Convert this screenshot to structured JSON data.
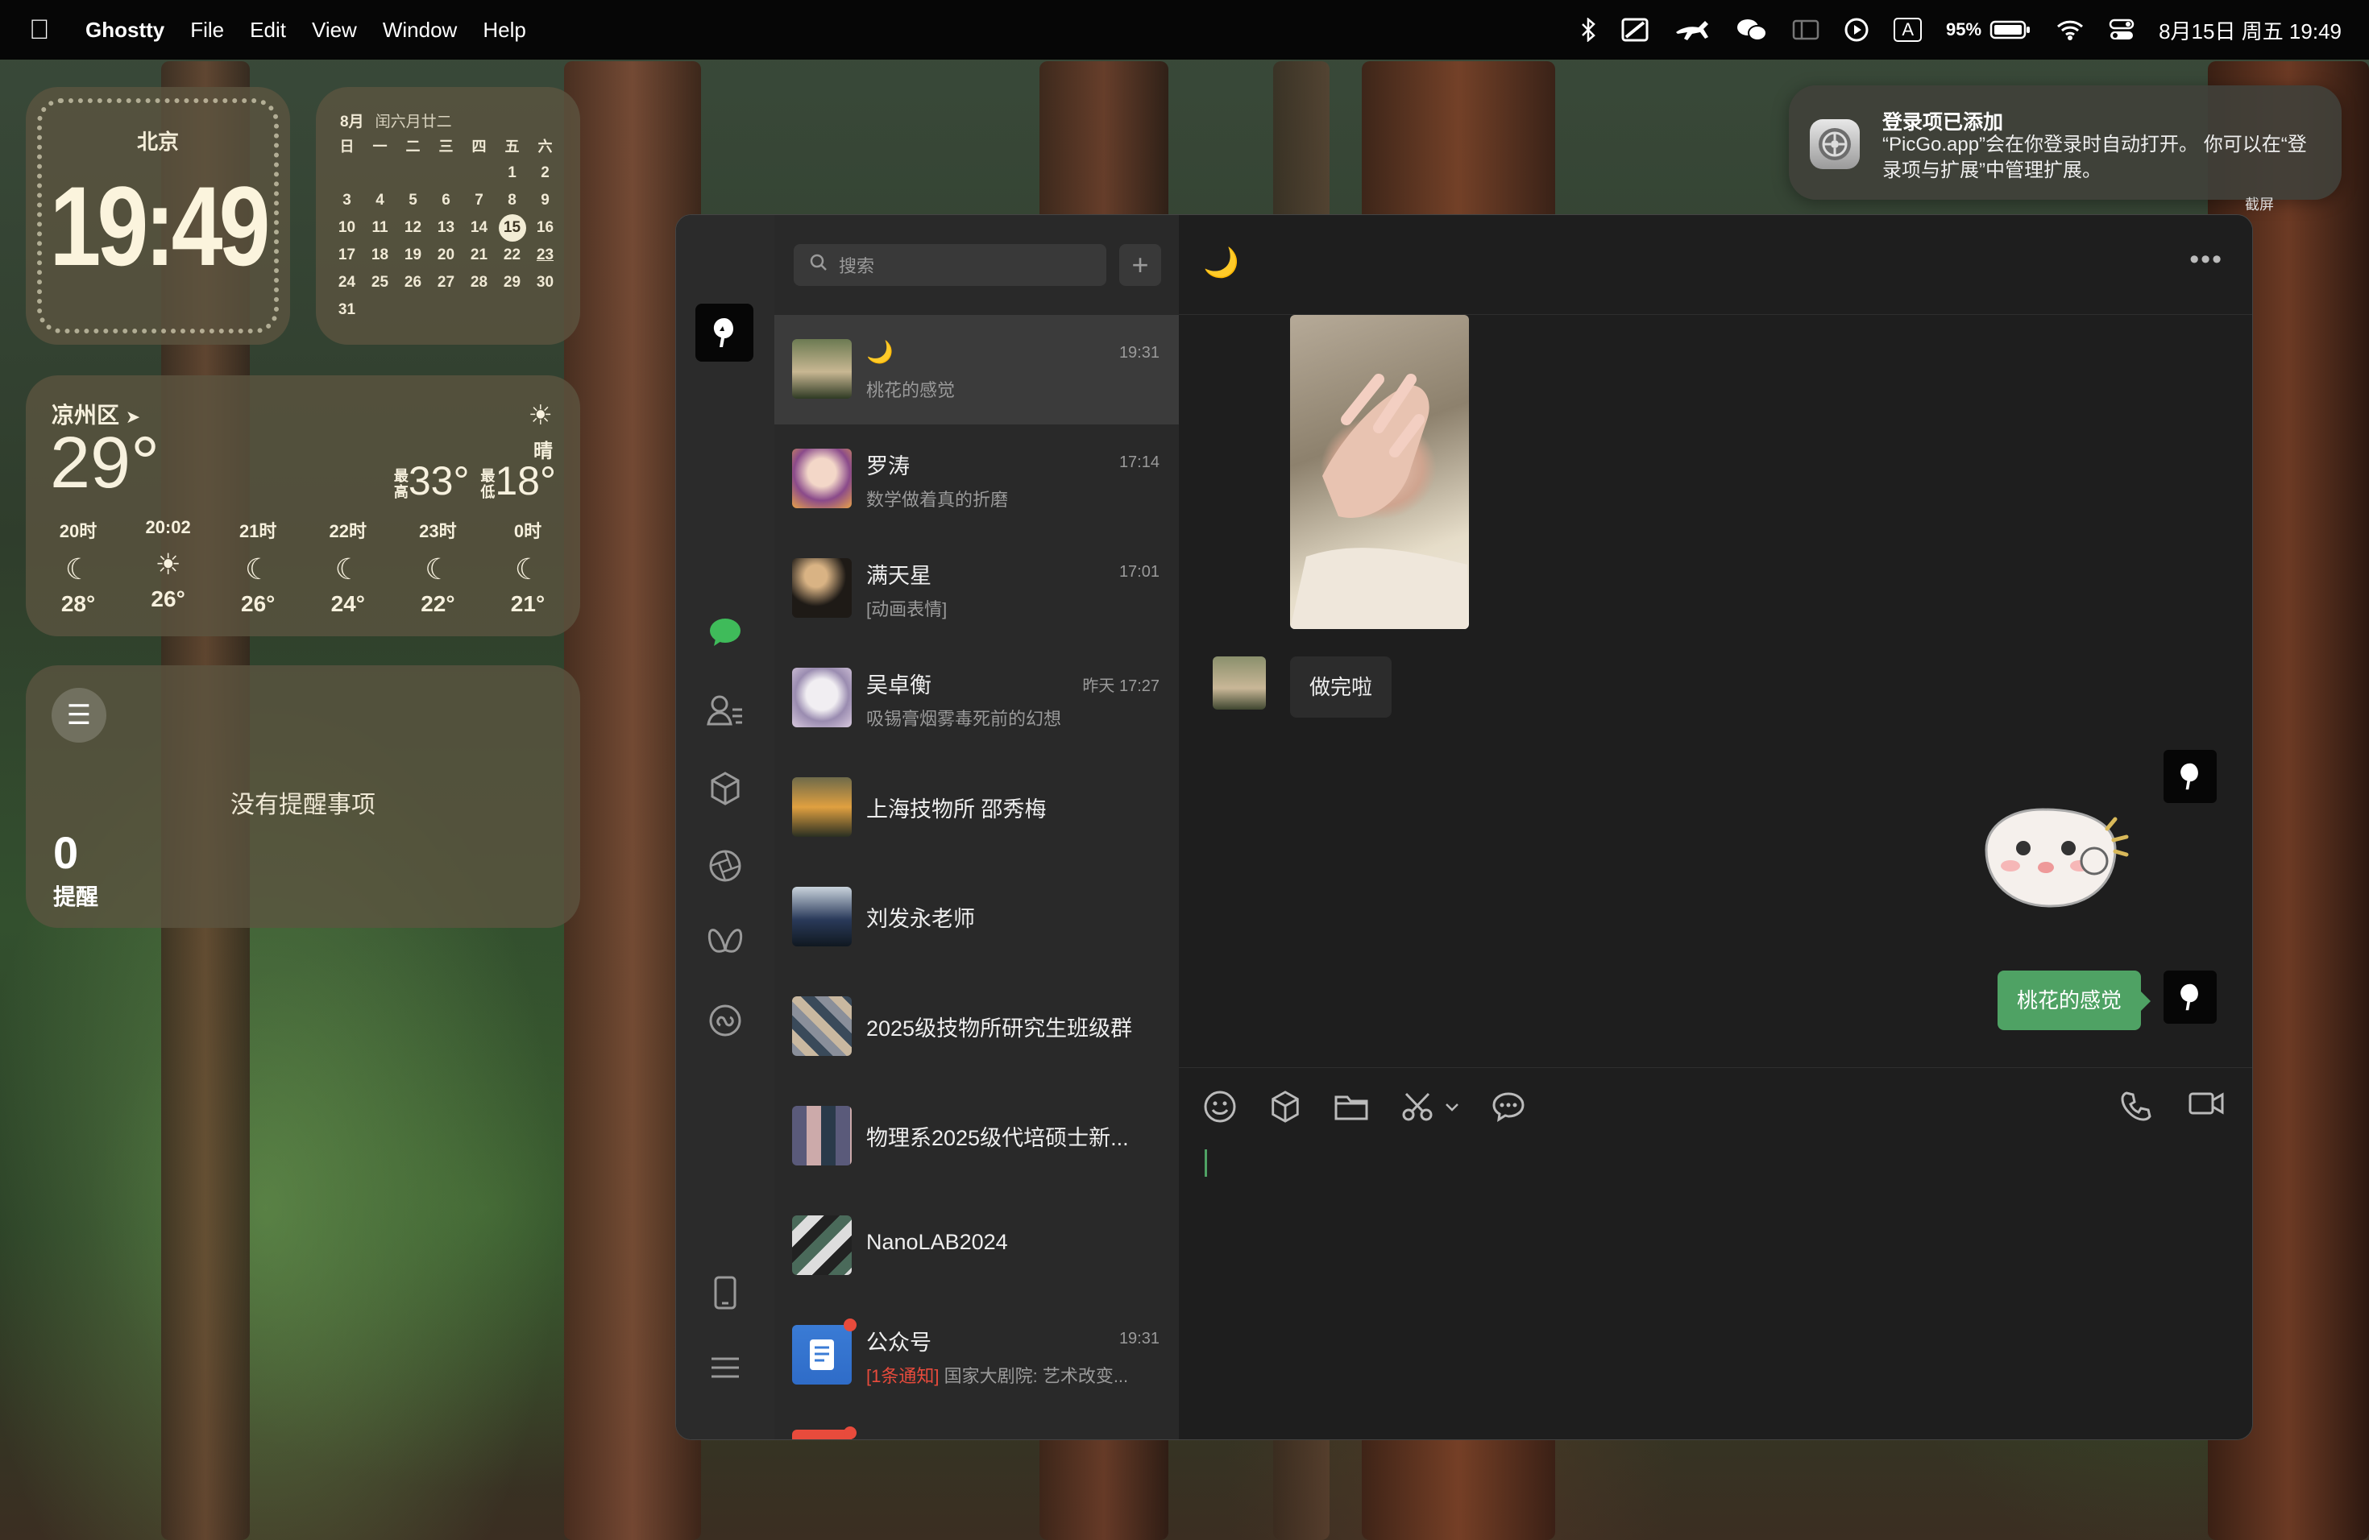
{
  "menubar": {
    "app": "Ghostty",
    "items": [
      "File",
      "Edit",
      "View",
      "Window",
      "Help"
    ],
    "battery": "95%",
    "datetime": "8月15日 周五 19:49",
    "input": "A"
  },
  "clock": {
    "city": "北京",
    "time": "19:49"
  },
  "calendar": {
    "month": "8月",
    "lunar": "闰六月廿二",
    "weekdays": [
      "日",
      "一",
      "二",
      "三",
      "四",
      "五",
      "六"
    ],
    "rows": [
      [
        "",
        "",
        "",
        "",
        "",
        "1",
        "2"
      ],
      [
        "3",
        "4",
        "5",
        "6",
        "7",
        "8",
        "9"
      ],
      [
        "10",
        "11",
        "12",
        "13",
        "14",
        "15",
        "16"
      ],
      [
        "17",
        "18",
        "19",
        "20",
        "21",
        "22",
        "23"
      ],
      [
        "24",
        "25",
        "26",
        "27",
        "28",
        "29",
        "30"
      ],
      [
        "31",
        "",
        "",
        "",
        "",
        "",
        ""
      ]
    ],
    "today": "15"
  },
  "weather": {
    "location": "凉州区",
    "temp": "29°",
    "condition": "晴",
    "high_label": "最高",
    "high": "33°",
    "low_label": "最低",
    "low": "18°",
    "hours": [
      {
        "time": "20时",
        "icon": "moon",
        "temp": "28°"
      },
      {
        "time": "20:02",
        "icon": "sunset",
        "temp": "26°"
      },
      {
        "time": "21时",
        "icon": "moon",
        "temp": "26°"
      },
      {
        "time": "22时",
        "icon": "moon",
        "temp": "24°"
      },
      {
        "time": "23时",
        "icon": "moon",
        "temp": "22°"
      },
      {
        "time": "0时",
        "icon": "moon",
        "temp": "21°"
      }
    ]
  },
  "reminders": {
    "message": "没有提醒事项",
    "count": "0",
    "label": "提醒"
  },
  "notification": {
    "title": "登录项已添加",
    "body": "“PicGo.app”会在你登录时自动打开。 你可以在“登录项与扩展”中管理扩展。",
    "edge_text": "截屏"
  },
  "wechat": {
    "search_placeholder": "搜索",
    "chats": [
      {
        "name": "🌙",
        "time": "19:31",
        "preview": "桃花的感觉"
      },
      {
        "name": "罗涛",
        "time": "17:14",
        "preview": "数学做着真的折磨"
      },
      {
        "name": "满天星",
        "time": "17:01",
        "preview": "[动画表情]"
      },
      {
        "name": "吴卓衡",
        "time": "昨天 17:27",
        "preview": "吸锡膏烟雾毒死前的幻想"
      },
      {
        "name": "上海技物所 邵秀梅",
        "time": "",
        "preview": ""
      },
      {
        "name": "刘发永老师",
        "time": "",
        "preview": ""
      },
      {
        "name": "2025级技物所研究生班级群",
        "time": "",
        "preview": ""
      },
      {
        "name": "物理系2025级代培硕士新...",
        "time": "",
        "preview": ""
      },
      {
        "name": "NanoLAB2024",
        "time": "",
        "preview": ""
      },
      {
        "name": "公众号",
        "time": "19:31",
        "preview_tag": "[1条通知]",
        "preview": "国家大剧院: 艺术改变..."
      }
    ],
    "active_chat_title": "🌙",
    "messages": {
      "incoming_text": "做完啦",
      "outgoing_text": "桃花的感觉"
    }
  },
  "colors": {
    "accent_green": "#4fa264",
    "badge_red": "#e84b3c"
  }
}
